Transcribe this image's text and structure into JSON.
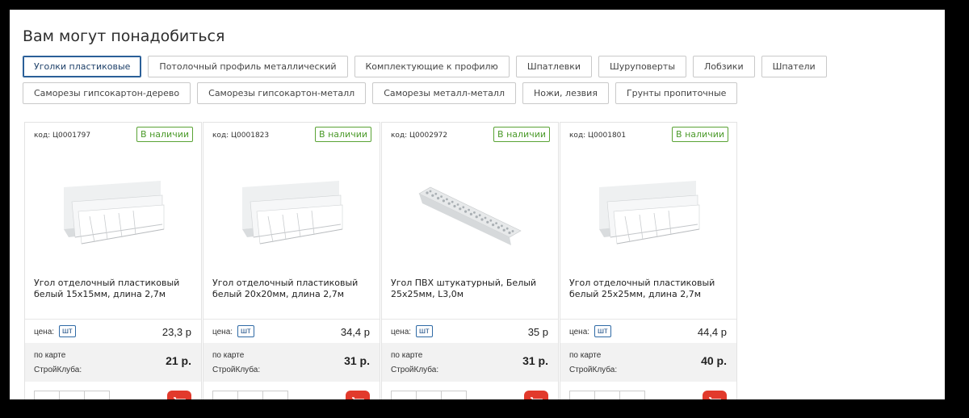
{
  "section_title": "Вам могут понадобиться",
  "tags": [
    [
      "Уголки пластиковые",
      "Потолочный профиль металлический",
      "Комплектующие к профилю",
      "Шпатлевки",
      "Шуруповерты",
      "Лобзики",
      "Шпатели"
    ],
    [
      "Саморезы гипсокартон-дерево",
      "Саморезы гипсокартон-металл",
      "Саморезы металл-металл",
      "Ножи, лезвия",
      "Грунты пропиточные"
    ]
  ],
  "active_tag": "Уголки пластиковые",
  "labels": {
    "price": "цена:",
    "unit": "шт",
    "club_line1": "по карте",
    "club_line2": "СтройКлуба:"
  },
  "products": [
    {
      "code": "код: Ц0001797",
      "stock": "В наличии",
      "name": "Угол отделочный пластиковый белый 15х15мм, длина 2,7м",
      "price": "23,3 р",
      "club_price": "21 р.",
      "image": "plastic-corner"
    },
    {
      "code": "код: Ц0001823",
      "stock": "В наличии",
      "name": "Угол отделочный пластиковый белый 20х20мм, длина 2,7м",
      "price": "34,4 р",
      "club_price": "31 р.",
      "image": "plastic-corner"
    },
    {
      "code": "код: Ц0002972",
      "stock": "В наличии",
      "name": "Угол ПВХ штукатурный, Белый 25х25мм, L3,0м",
      "price": "35 р",
      "club_price": "31 р.",
      "image": "perforated-corner"
    },
    {
      "code": "код: Ц0001801",
      "stock": "В наличии",
      "name": "Угол отделочный пластиковый белый 25х25мм, длина 2,7м",
      "price": "44,4 р",
      "club_price": "40 р.",
      "image": "plastic-corner"
    }
  ],
  "colors": {
    "stock_green": "#5aa335",
    "accent_blue": "#2a5f98",
    "cart_red": "#e23a2c"
  },
  "icons": {
    "cart": "cart-icon",
    "minus": "minus-icon",
    "plus": "plus-icon"
  }
}
